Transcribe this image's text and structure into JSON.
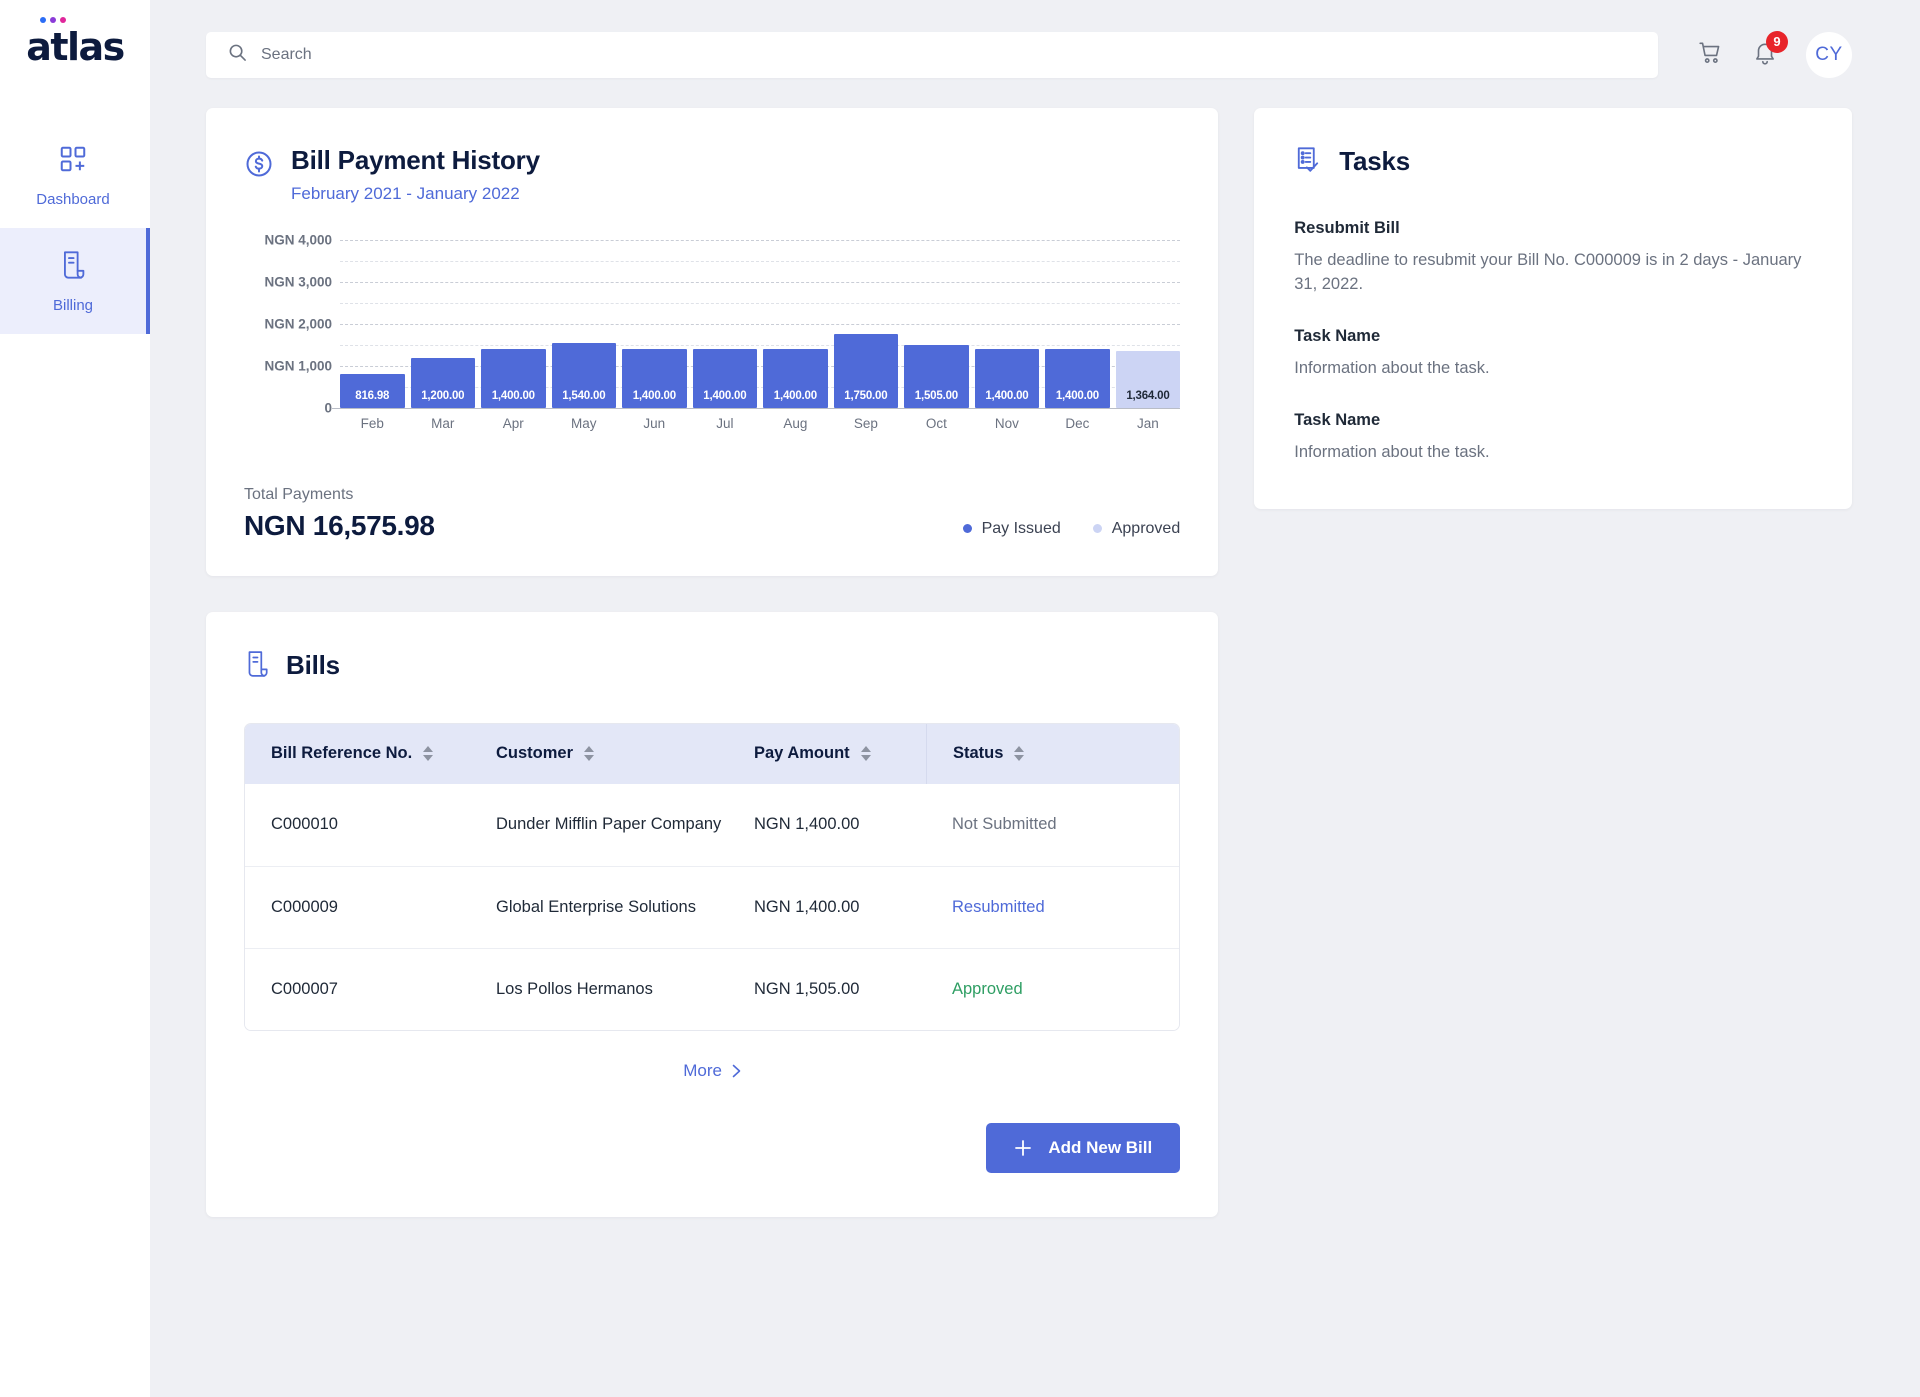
{
  "sidebar": {
    "logo_text": "atlas",
    "logo_dot_colors": [
      "#2b6df6",
      "#8b3bd8",
      "#e0279b"
    ],
    "items": [
      {
        "label": "Dashboard",
        "icon": "dashboard-add-icon",
        "active": false
      },
      {
        "label": "Billing",
        "icon": "billing-document-icon",
        "active": true
      }
    ]
  },
  "header": {
    "search_placeholder": "Search",
    "search_value": "",
    "search_icon": "search-icon",
    "cart_icon": "shopping-cart-icon",
    "bell_icon": "notification-bell-icon",
    "notification_count": "9",
    "avatar_initials": "CY"
  },
  "chart_card": {
    "icon": "dollar-circle-icon",
    "title": "Bill Payment History",
    "subtitle": "February 2021 - January 2022",
    "total_label": "Total Payments",
    "total_value": "NGN 16,575.98",
    "legend": [
      {
        "label": "Pay Issued",
        "color": "#4f6ad8"
      },
      {
        "label": "Approved",
        "color": "#ccd4f4"
      }
    ]
  },
  "chart_data": {
    "type": "bar",
    "title": "Bill Payment History",
    "subtitle": "February 2021 - January 2022",
    "xlabel": "",
    "ylabel": "",
    "ylim": [
      0,
      4000
    ],
    "grid": true,
    "legend_position": "bottom-right",
    "ytick_labels": [
      "0",
      "NGN 1,000",
      "NGN 2,000",
      "NGN 3,000",
      "NGN 4,000"
    ],
    "ytick_values": [
      0,
      1000,
      2000,
      3000,
      4000
    ],
    "minor_gridlines": [
      500,
      1500,
      2500,
      3500
    ],
    "categories": [
      "Feb",
      "Mar",
      "Apr",
      "May",
      "Jun",
      "Jul",
      "Aug",
      "Sep",
      "Oct",
      "Nov",
      "Dec",
      "Jan"
    ],
    "values": [
      816.98,
      1200.0,
      1400.0,
      1540.0,
      1400.0,
      1400.0,
      1400.0,
      1750.0,
      1505.0,
      1400.0,
      1400.0,
      1364.0
    ],
    "data_labels": [
      "816.98",
      "1,200.00",
      "1,400.00",
      "1,540.00",
      "1,400.00",
      "1,400.00",
      "1,400.00",
      "1,750.00",
      "1,505.00",
      "1,400.00",
      "1,400.00",
      "1,364.00"
    ],
    "series_of_bar": [
      "Pay Issued",
      "Pay Issued",
      "Pay Issued",
      "Pay Issued",
      "Pay Issued",
      "Pay Issued",
      "Pay Issued",
      "Pay Issued",
      "Pay Issued",
      "Pay Issued",
      "Pay Issued",
      "Approved"
    ],
    "series": [
      {
        "name": "Pay Issued",
        "color": "#4f6ad8",
        "label_color": "#ffffff"
      },
      {
        "name": "Approved",
        "color": "#ccd4f4",
        "label_color": "#1f2937"
      }
    ],
    "total": "NGN 16,575.98"
  },
  "tasks_card": {
    "icon": "tasks-checklist-icon",
    "title": "Tasks",
    "items": [
      {
        "name": "Resubmit Bill",
        "info": "The deadline to resubmit your Bill No. C000009 is in 2 days - January 31, 2022."
      },
      {
        "name": "Task Name",
        "info": "Information about the task."
      },
      {
        "name": "Task Name",
        "info": "Information about the task."
      }
    ]
  },
  "bills_card": {
    "icon": "billing-document-icon",
    "title": "Bills",
    "columns": [
      "Bill Reference No.",
      "Customer",
      "Pay Amount",
      "Status"
    ],
    "rows": [
      {
        "ref": "C000010",
        "customer": "Dunder Mifflin Paper Company",
        "amount": "NGN 1,400.00",
        "status": "Not Submitted",
        "status_class": "st-gray"
      },
      {
        "ref": "C000009",
        "customer": "Global Enterprise Solutions",
        "amount": "NGN 1,400.00",
        "status": "Resubmitted",
        "status_class": "st-blue"
      },
      {
        "ref": "C000007",
        "customer": "Los Pollos Hermanos",
        "amount": "NGN 1,505.00",
        "status": "Approved",
        "status_class": "st-green"
      }
    ],
    "more_label": "More",
    "add_button_label": "Add New Bill",
    "add_icon": "plus-icon"
  }
}
